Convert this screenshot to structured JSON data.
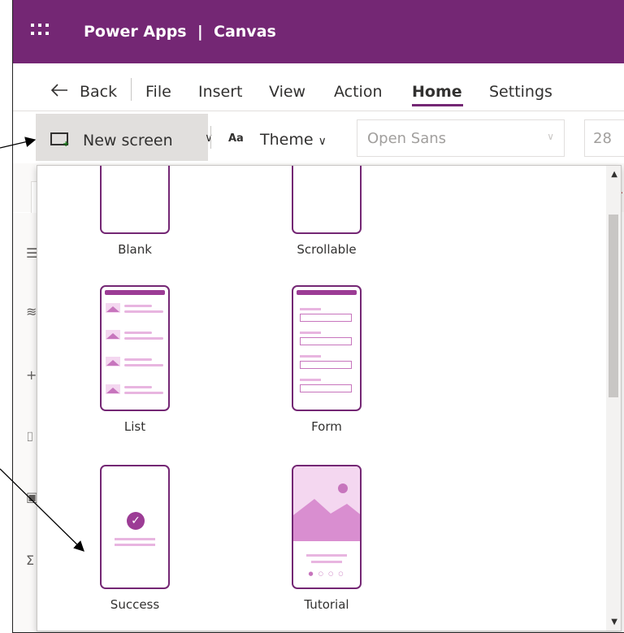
{
  "appbar": {
    "title": "Power Apps  |  Canvas"
  },
  "menu": {
    "back": "Back",
    "items": [
      "File",
      "Insert",
      "View",
      "Action",
      "Home",
      "Settings"
    ],
    "active": "Home"
  },
  "toolbar": {
    "new_screen": "New screen",
    "theme_icon_text": "Aa",
    "theme": "Theme",
    "font": "Open Sans",
    "size": "28"
  },
  "right_clip": "1",
  "background_text": "",
  "templates": [
    {
      "label": "Blank"
    },
    {
      "label": "Scrollable"
    },
    {
      "label": "List"
    },
    {
      "label": "Form"
    },
    {
      "label": "Success"
    },
    {
      "label": "Tutorial"
    }
  ],
  "colors": {
    "brand": "#742774",
    "accent": "#9c3c95",
    "light": "#f4d7f0"
  }
}
